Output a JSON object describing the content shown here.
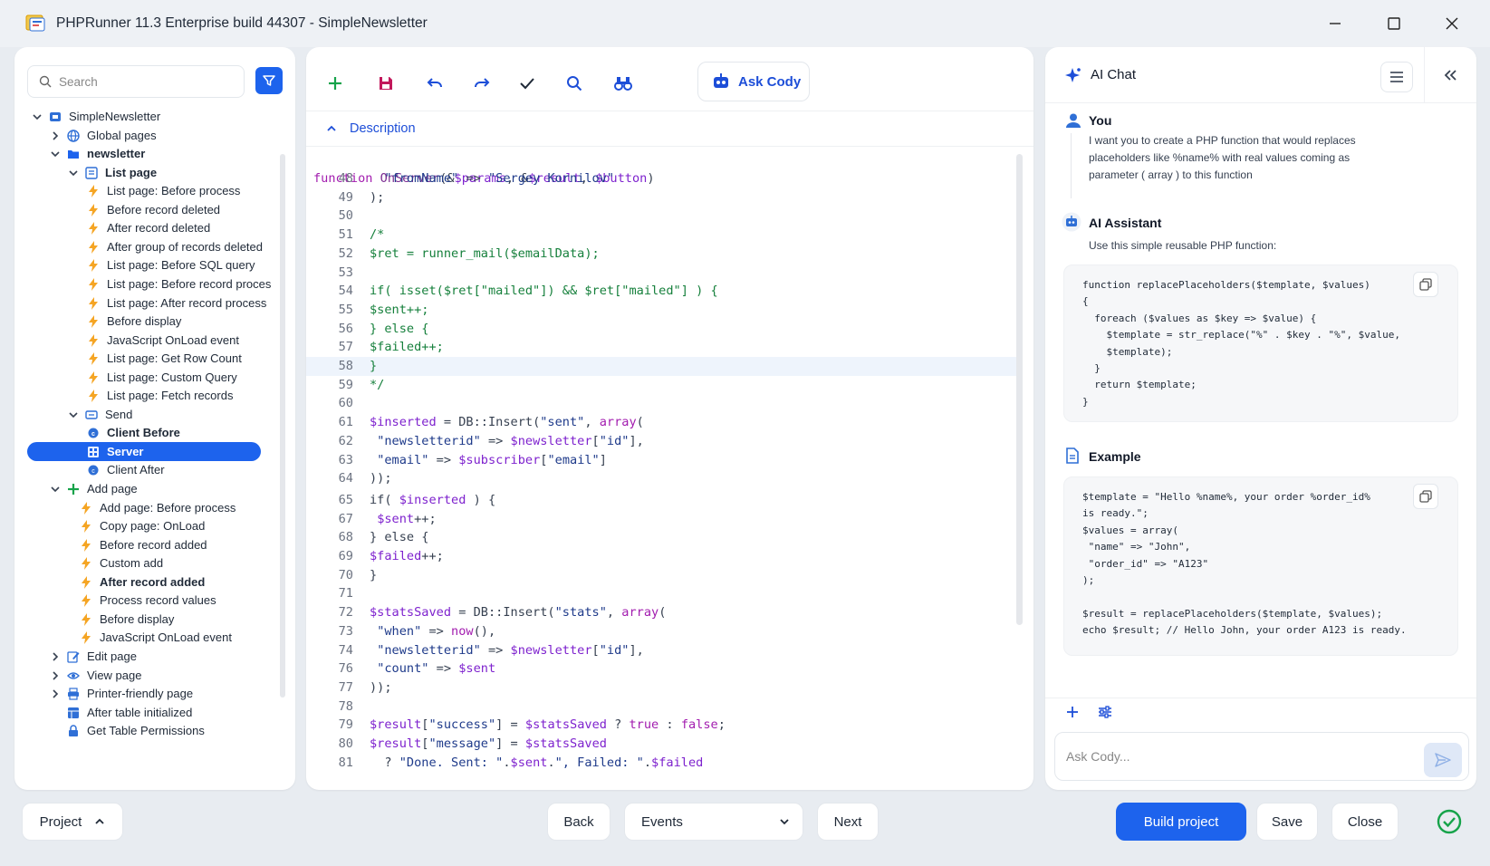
{
  "window": {
    "title": "PHPRunner 11.3 Enterprise build 44307 - SimpleNewsletter",
    "minimize": "—",
    "maximize": "☐",
    "close": "✕"
  },
  "sidebar": {
    "search_placeholder": "Search",
    "tree": [
      {
        "label": "SimpleNewsletter",
        "icon": "project-icon",
        "chevron": "down",
        "level": 0
      },
      {
        "label": "Global pages",
        "icon": "globe-icon",
        "chevron": "right",
        "level": 1
      },
      {
        "label": "newsletter",
        "icon": "folder-icon",
        "chevron": "down",
        "level": 1,
        "bold": true
      },
      {
        "label": "List page",
        "icon": "list-icon",
        "chevron": "down",
        "level": 2,
        "bold": true
      },
      {
        "label": "List page: Before process",
        "icon": "bolt-icon",
        "level": 3
      },
      {
        "label": "Before record deleted",
        "icon": "bolt-icon",
        "level": 3
      },
      {
        "label": "After record deleted",
        "icon": "bolt-icon",
        "level": 3
      },
      {
        "label": "After group of records deleted",
        "icon": "bolt-icon",
        "level": 3
      },
      {
        "label": "List page: Before SQL query",
        "icon": "bolt-icon",
        "level": 3
      },
      {
        "label": "List page: Before record proces",
        "icon": "bolt-icon",
        "level": 3
      },
      {
        "label": "List page: After record process",
        "icon": "bolt-icon",
        "level": 3
      },
      {
        "label": "Before display",
        "icon": "bolt-icon",
        "level": 3
      },
      {
        "label": "JavaScript OnLoad event",
        "icon": "bolt-icon",
        "level": 3
      },
      {
        "label": "List page: Get Row Count",
        "icon": "bolt-icon",
        "level": 3
      },
      {
        "label": "List page: Custom Query",
        "icon": "bolt-icon",
        "level": 3
      },
      {
        "label": "List page: Fetch records",
        "icon": "bolt-icon",
        "level": 3
      },
      {
        "label": "Send",
        "icon": "button-icon",
        "chevron": "down",
        "level": 2
      },
      {
        "label": "Client Before",
        "icon": "client-icon",
        "level": 3,
        "bold": true
      },
      {
        "label": "Server",
        "icon": "server-icon",
        "level": 3,
        "bold": true,
        "selected": true
      },
      {
        "label": "Client After",
        "icon": "client-icon",
        "level": 3
      },
      {
        "label": "Add page",
        "icon": "plus-icon",
        "chevron": "down",
        "level": 1
      },
      {
        "label": "Add page: Before process",
        "icon": "bolt-icon",
        "level": 2
      },
      {
        "label": "Copy page: OnLoad",
        "icon": "bolt-icon",
        "level": 2
      },
      {
        "label": "Before record added",
        "icon": "bolt-icon",
        "level": 2
      },
      {
        "label": "Custom add",
        "icon": "bolt-icon",
        "level": 2
      },
      {
        "label": "After record added",
        "icon": "bolt-icon",
        "level": 2,
        "bold": true
      },
      {
        "label": "Process record values",
        "icon": "bolt-icon",
        "level": 2
      },
      {
        "label": "Before display",
        "icon": "bolt-icon",
        "level": 2
      },
      {
        "label": "JavaScript OnLoad event",
        "icon": "bolt-icon",
        "level": 2
      },
      {
        "label": "Edit page",
        "icon": "edit-icon",
        "chevron": "right",
        "level": 1
      },
      {
        "label": "View page",
        "icon": "eye-icon",
        "chevron": "right",
        "level": 1
      },
      {
        "label": "Printer-friendly page",
        "icon": "printer-icon",
        "chevron": "right",
        "level": 1
      },
      {
        "label": "After table initialized",
        "icon": "table-icon",
        "level": 1
      },
      {
        "label": "Get Table Permissions",
        "icon": "lock-icon",
        "level": 1
      }
    ]
  },
  "toolbar": {
    "ask_cody": "Ask Cody"
  },
  "editor": {
    "section": "Description",
    "header_line": "function OnServer(&$params, &$result, $button)",
    "lines": [
      {
        "n": "48",
        "t": "  \"fromName\" => \"Sergey Kornilov\""
      },
      {
        "n": "49",
        "t": ");"
      },
      {
        "n": "50",
        "t": ""
      },
      {
        "n": "51",
        "t": "/*"
      },
      {
        "n": "52",
        "t": "$ret = runner_mail($emailData);"
      },
      {
        "n": "53",
        "t": ""
      },
      {
        "n": "54",
        "t": "if( isset($ret[\"mailed\"]) && $ret[\"mailed\"] ) {"
      },
      {
        "n": "55",
        "t": "$sent++;"
      },
      {
        "n": "56",
        "t": "} else {"
      },
      {
        "n": "57",
        "t": "$failed++;"
      },
      {
        "n": "58",
        "t": "}"
      },
      {
        "n": "59",
        "t": "*/"
      },
      {
        "n": "60",
        "t": ""
      },
      {
        "n": "61",
        "t": "$inserted = DB::Insert(\"sent\", array("
      },
      {
        "n": "62",
        "t": " \"newsletterid\" => $newsletter[\"id\"],"
      },
      {
        "n": "63",
        "t": " \"email\" => $subscriber[\"email\"]"
      },
      {
        "n": "64",
        "t": "));"
      },
      {
        "n": "65",
        "t": "if( $inserted ) {"
      },
      {
        "n": "67",
        "t": " $sent++;"
      },
      {
        "n": "68",
        "t": "} else {"
      },
      {
        "n": "69",
        "t": "$failed++;"
      },
      {
        "n": "70",
        "t": "}"
      },
      {
        "n": "71",
        "t": ""
      },
      {
        "n": "72",
        "t": "$statsSaved = DB::Insert(\"stats\", array("
      },
      {
        "n": "73",
        "t": " \"when\" => now(),"
      },
      {
        "n": "74",
        "t": " \"newsletterid\" => $newsletter[\"id\"],"
      },
      {
        "n": "76",
        "t": " \"count\" => $sent"
      },
      {
        "n": "77",
        "t": "));"
      },
      {
        "n": "78",
        "t": ""
      },
      {
        "n": "79",
        "t": "$result[\"success\"] = $statsSaved ? true : false;"
      },
      {
        "n": "80",
        "t": "$result[\"message\"] = $statsSaved"
      },
      {
        "n": "81",
        "t": "  ? \"Done. Sent: \".$sent.\", Failed: \".$failed"
      }
    ]
  },
  "ai_chat": {
    "title": "AI Chat",
    "user_name": "You",
    "user_message": "I want you to create a PHP function that would replaces placeholders like %name% with real values coming as parameter ( array ) to this function",
    "assistant_name": "AI Assistant",
    "assistant_intro": "Use this simple reusable PHP function:",
    "function_code": [
      "function replacePlaceholders($template, $values)",
      "{",
      "  foreach ($values as $key => $value) {",
      "    $template = str_replace(\"%\" . $key . \"%\", $value,",
      "    $template);",
      "  }",
      "  return $template;",
      "}"
    ],
    "example_title": "Example",
    "example_code": [
      "$template = \"Hello %name%, your order %order_id%",
      "is ready.\";",
      "$values = array(",
      " \"name\" => \"John\",",
      " \"order_id\" => \"A123\"",
      ");",
      "",
      "$result = replacePlaceholders($template, $values);",
      "echo $result; // Hello John, your order A123 is ready."
    ],
    "input_placeholder": "Ask Cody..."
  },
  "footer": {
    "project": "Project",
    "back": "Back",
    "events": "Events",
    "next": "Next",
    "build": "Build project",
    "save": "Save",
    "close": "Close"
  },
  "colors": {
    "accent": "#1d63ed",
    "bolt": "#f5a524",
    "success": "#16a34a"
  }
}
